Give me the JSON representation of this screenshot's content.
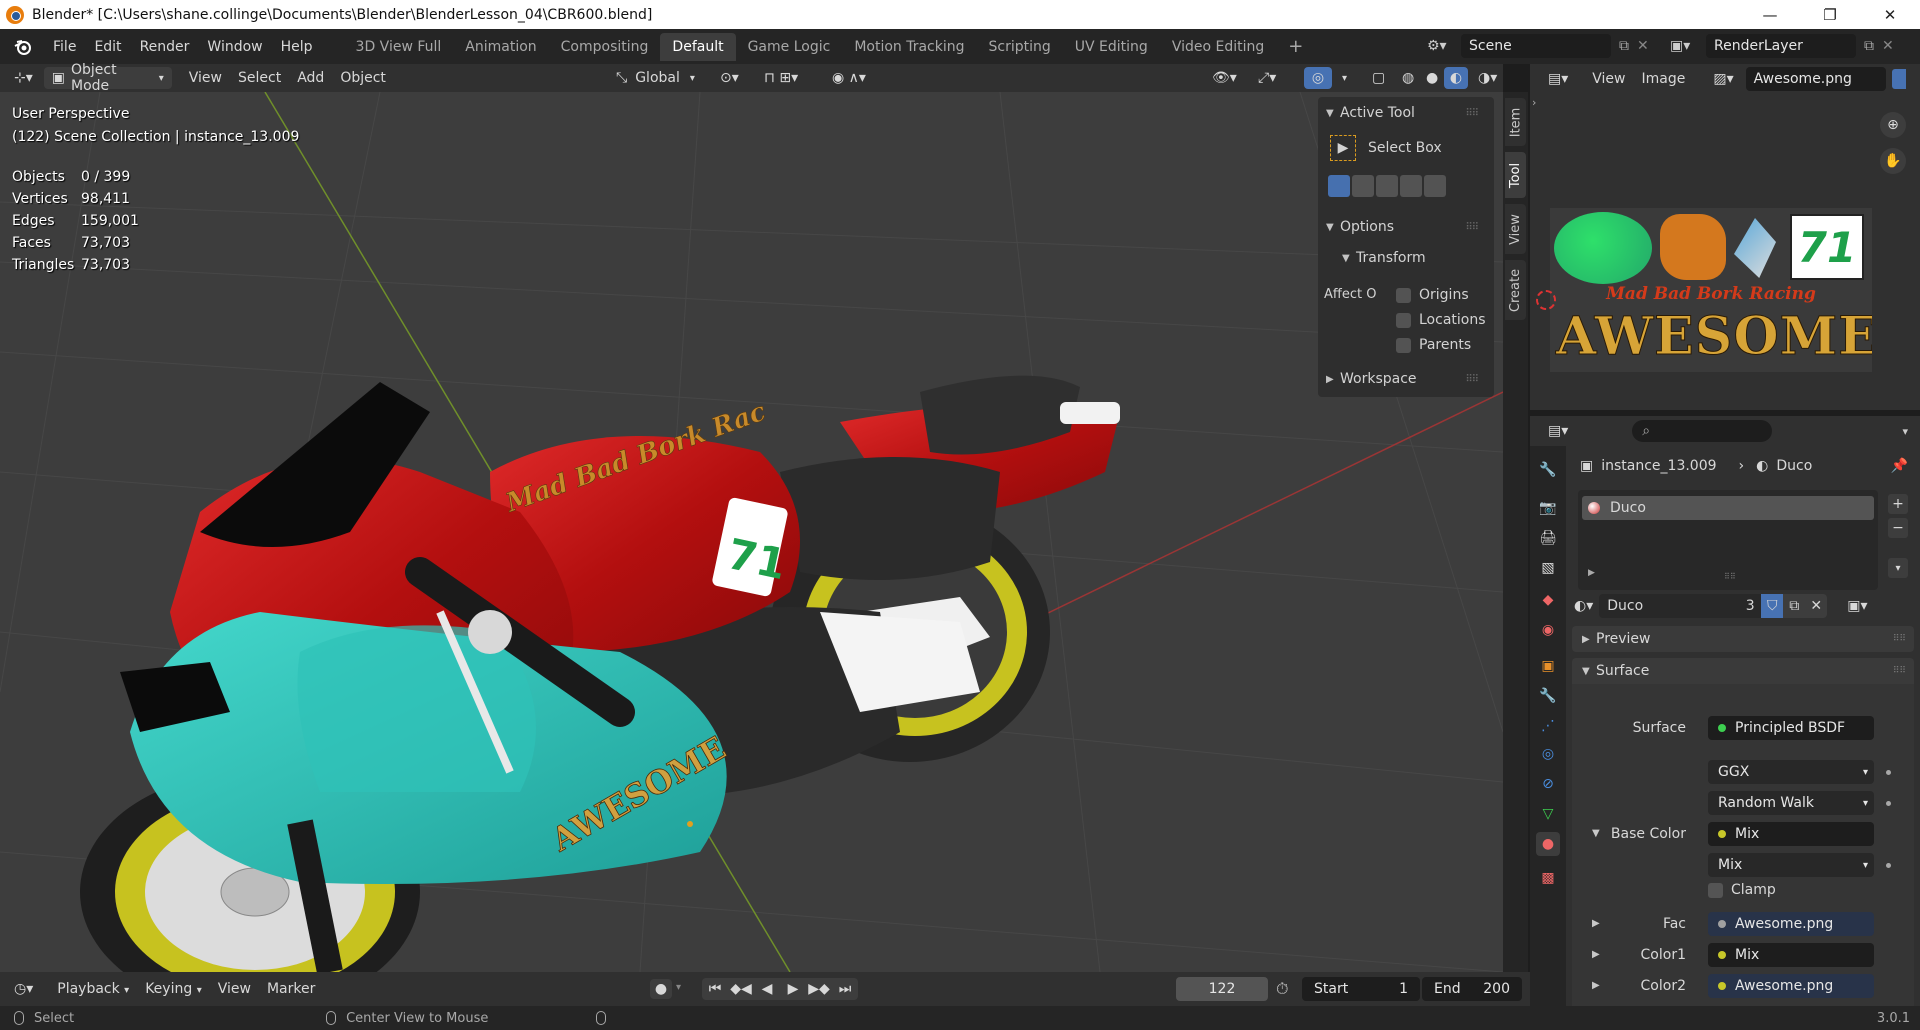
{
  "window": {
    "title": "Blender* [C:\\Users\\shane.collinge\\Documents\\Blender\\BlenderLesson_04\\CBR600.blend]",
    "minimize": "—",
    "maximize": "❐",
    "close": "✕"
  },
  "menu": [
    "File",
    "Edit",
    "Render",
    "Window",
    "Help"
  ],
  "workspaces": [
    "3D View Full",
    "Animation",
    "Compositing",
    "Default",
    "Game Logic",
    "Motion Tracking",
    "Scripting",
    "UV Editing",
    "Video Editing"
  ],
  "active_workspace": "Default",
  "add_workspace": "+",
  "scene": {
    "name": "Scene",
    "render_layer": "RenderLayer"
  },
  "viewport_header": {
    "mode": "Object Mode",
    "menus": [
      "View",
      "Select",
      "Add",
      "Object"
    ],
    "orientation": "Global"
  },
  "viewport": {
    "perspective": "User Perspective",
    "collection": "(122) Scene Collection | instance_13.009",
    "stats": [
      {
        "label": "Objects",
        "value": "0 / 399"
      },
      {
        "label": "Vertices",
        "value": "98,411"
      },
      {
        "label": "Edges",
        "value": "159,001"
      },
      {
        "label": "Faces",
        "value": "73,703"
      },
      {
        "label": "Triangles",
        "value": "73,703"
      }
    ],
    "decal_brand": "Mad Bad Bork Rac",
    "decal_number": "71",
    "decal_side": "AWESOME"
  },
  "npanel": {
    "active_tool_header": "Active Tool",
    "tool_name": "Select Box",
    "options_header": "Options",
    "transform_header": "Transform",
    "affect_label": "Affect O",
    "affect_options": [
      "Origins",
      "Locations",
      "Parents"
    ],
    "workspace_header": "Workspace",
    "tabs": [
      "Item",
      "Tool",
      "View",
      "Create"
    ],
    "active_tab": "Tool"
  },
  "image_editor": {
    "menus": [
      "View",
      "Image"
    ],
    "image_name": "Awesome.png",
    "texture_brand": "Mad Bad Bork Racing",
    "texture_title": "AWESOME",
    "texture_number": "71"
  },
  "properties": {
    "breadcrumb_object": "instance_13.009",
    "breadcrumb_material": "Duco",
    "slot_name": "Duco",
    "material_name": "Duco",
    "user_count": "3",
    "preview_header": "Preview",
    "surface_header": "Surface",
    "surface_label": "Surface",
    "surface_shader": "Principled BSDF",
    "distribution": "GGX",
    "subsurface": "Random Walk",
    "base_color_label": "Base Color",
    "base_color_value": "Mix",
    "blend_mode": "Mix",
    "clamp_label": "Clamp",
    "fac_label": "Fac",
    "fac_value": "Awesome.png",
    "color1_label": "Color1",
    "color1_value": "Mix",
    "color2_label": "Color2",
    "color2_value": "Awesome.png"
  },
  "timeline": {
    "menus": [
      "Playback",
      "Keying",
      "View",
      "Marker"
    ],
    "current_frame": "122",
    "start_label": "Start",
    "start": "1",
    "end_label": "End",
    "end": "200"
  },
  "status": {
    "left_action": "Select",
    "middle_action": "Center View to Mouse",
    "version": "3.0.1"
  },
  "colors": {
    "accent_blue": "#4772b3",
    "bike_red": "#c41414",
    "bike_teal": "#25b8b0",
    "wheel_yellow": "#c7c21f",
    "shader_green": "#3dcf50",
    "socket_yellow": "#c7c729",
    "socket_blue": "#6363c7"
  }
}
